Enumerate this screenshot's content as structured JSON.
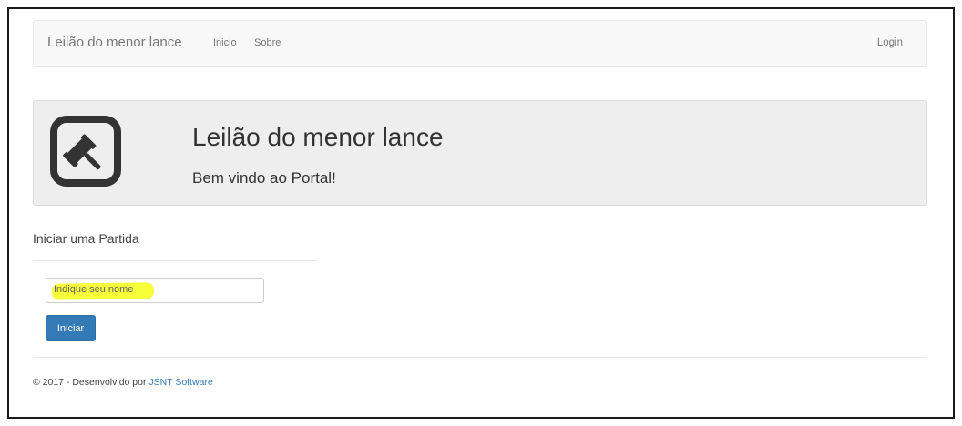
{
  "navbar": {
    "brand": "Leilão do menor lance",
    "links": [
      "Inicio",
      "Sobre"
    ],
    "login": "Login"
  },
  "jumbotron": {
    "logo_icon": "gavel-icon",
    "title": "Leilão do menor lance",
    "subtitle": "Bem vindo ao Portal!"
  },
  "start_game": {
    "heading": "Iniciar uma Partida",
    "name_placeholder": "Indique seu nome",
    "highlight_color": "#f7ff3a",
    "submit_label": "Iniciar"
  },
  "footer": {
    "prefix": "© 2017 - Desenvolvido por ",
    "link_text": "JSNT Software"
  },
  "colors": {
    "primary": "#337ab7",
    "navbar_bg": "#f8f8f8",
    "jumbotron_bg": "#eeeeee"
  }
}
